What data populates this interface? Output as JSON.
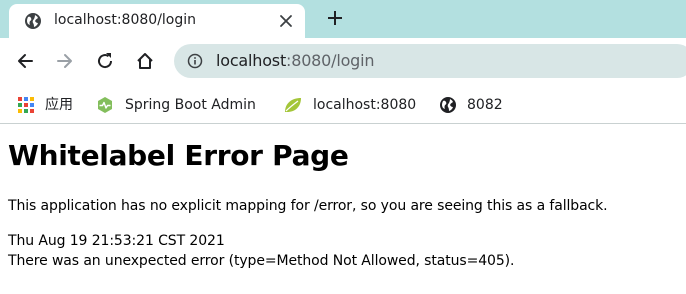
{
  "browser": {
    "tab": {
      "title": "localhost:8080/login",
      "favicon": "globe-icon"
    },
    "toolbar": {
      "url_host": "localhost",
      "url_rest": ":8080/login"
    },
    "bookmarks": [
      {
        "label": "应用",
        "icon": "apps-grid-icon"
      },
      {
        "label": "Spring Boot Admin",
        "icon": "spring-boot-admin-icon"
      },
      {
        "label": "localhost:8080",
        "icon": "spring-leaf-icon"
      },
      {
        "label": "8082",
        "icon": "globe-icon"
      }
    ],
    "colors": {
      "tabstrip": "#b3e0e0",
      "omnibox": "#d8e6e6"
    }
  },
  "page": {
    "heading": "Whitelabel Error Page",
    "message": "This application has no explicit mapping for /error, so you are seeing this as a fallback.",
    "timestamp": "Thu Aug 19 21:53:21 CST 2021",
    "error_detail": "There was an unexpected error (type=Method Not Allowed, status=405)."
  }
}
